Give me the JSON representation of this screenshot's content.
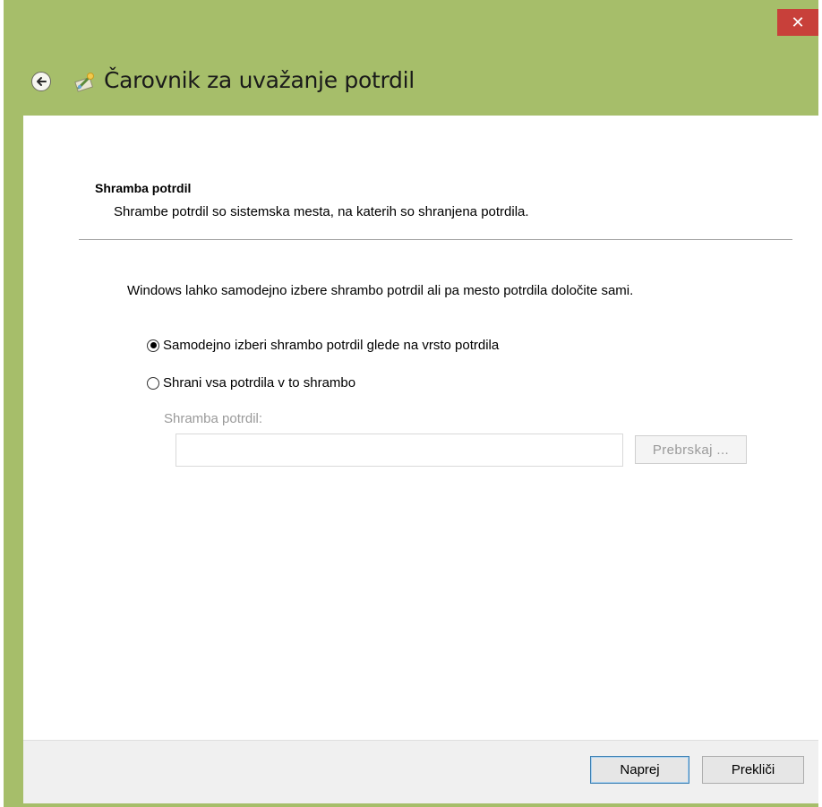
{
  "window": {
    "title": "Čarovnik za uvažanje potrdil",
    "close_glyph": "✕",
    "frame_color": "#a6be6a",
    "close_color": "#c8403a"
  },
  "section": {
    "title": "Shramba potrdil",
    "description": "Shrambe potrdil so sistemska mesta, na katerih so shranjena potrdila."
  },
  "main": {
    "intro": "Windows lahko samodejno izbere shrambo potrdil ali pa mesto potrdila določite sami.",
    "options": [
      {
        "label": "Samodejno izberi shrambo potrdil glede na vrsto potrdila",
        "selected": true
      },
      {
        "label": "Shrani vsa potrdila v to shrambo",
        "selected": false
      }
    ],
    "store_label": "Shramba potrdil:",
    "store_value": "",
    "browse_label": "Prebrskaj ..."
  },
  "footer": {
    "next_label": "Naprej",
    "cancel_label": "Prekliči"
  },
  "icons": {
    "back": "back-arrow-icon",
    "wizard": "certificate-wizard-icon",
    "close": "close-icon"
  }
}
